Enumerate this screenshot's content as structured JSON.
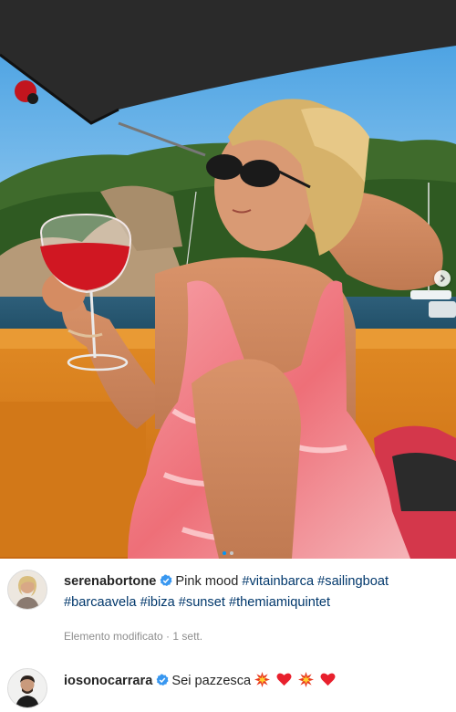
{
  "post": {
    "image_alt_icon": "photo",
    "carousel": {
      "count": 2,
      "active": 1
    }
  },
  "caption": {
    "username": "serenabortone",
    "text": "Pink mood",
    "hashtags": [
      "#vitainbarca",
      "#sailingboat",
      "#barcaavela",
      "#ibiza",
      "#sunset",
      "#themiamiquintet"
    ],
    "meta": "Elemento modificato · 1 sett."
  },
  "comment": {
    "username": "iosonocarrara",
    "text": "Sei pazzesca",
    "emojis": [
      "collision-icon",
      "heart-icon",
      "collision-icon",
      "heart-icon"
    ]
  },
  "colors": {
    "link": "#00376b",
    "verified": "#3897f0",
    "active_dot": "#0095f6"
  }
}
